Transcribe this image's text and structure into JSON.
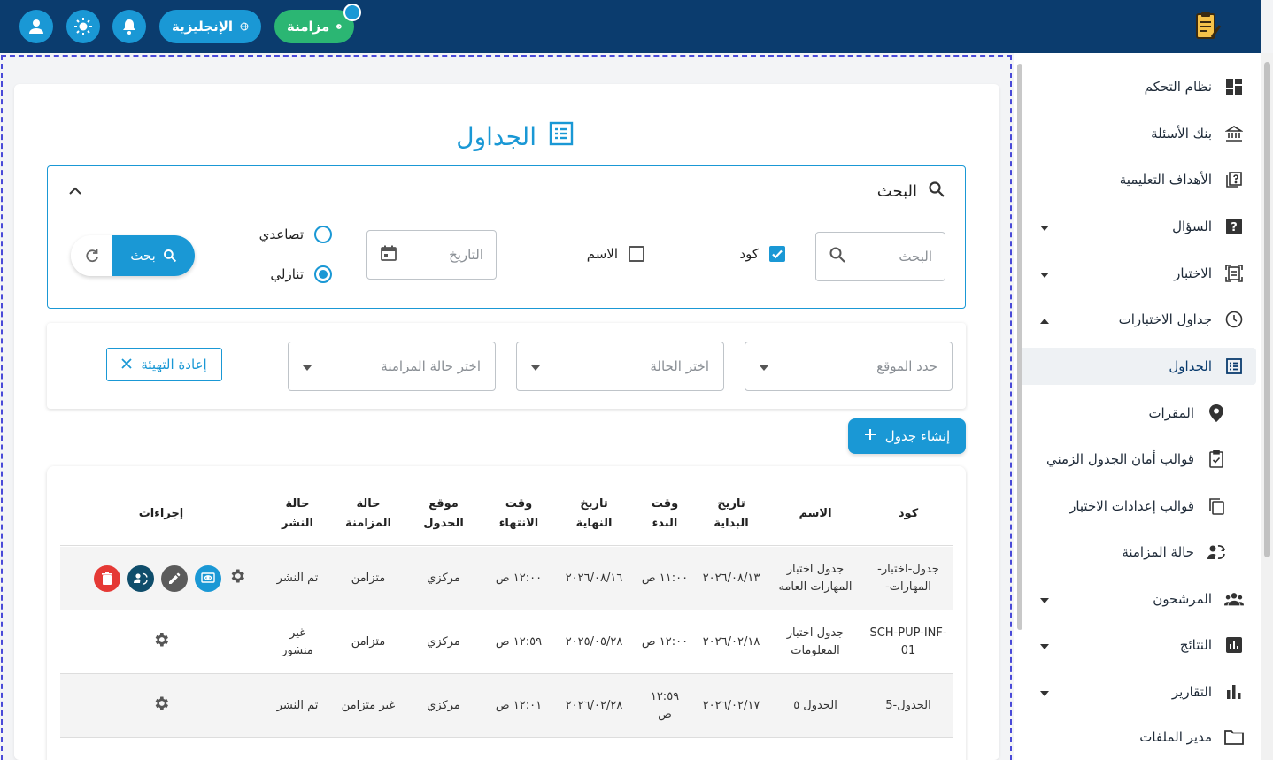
{
  "topbar": {
    "lang_label": "الإنجليزية",
    "sync_label": "مزامنة"
  },
  "sidebar": {
    "items": [
      {
        "label": "نظام التحكم",
        "icon": "dashboard-icon"
      },
      {
        "label": "بنك الأسئلة",
        "icon": "bank-icon"
      },
      {
        "label": "الأهداف التعليمية",
        "icon": "book-question-icon"
      },
      {
        "label": "السؤال",
        "icon": "question-icon"
      },
      {
        "label": "الاختبار",
        "icon": "exam-icon"
      },
      {
        "label": "جداول الاختبارات",
        "icon": "clock-icon"
      },
      {
        "label": "الجداول",
        "icon": "list-icon"
      },
      {
        "label": "المقرات",
        "icon": "location-icon"
      },
      {
        "label": "قوالب أمان الجدول الزمني",
        "icon": "clipboard-check-icon"
      },
      {
        "label": "قوالب إعدادات الاختبار",
        "icon": "copy-icon"
      },
      {
        "label": "حالة المزامنة",
        "icon": "sync-status-icon"
      },
      {
        "label": "المرشحون",
        "icon": "people-icon"
      },
      {
        "label": "النتائج",
        "icon": "chart-box-icon"
      },
      {
        "label": "التقارير",
        "icon": "bar-chart-icon"
      },
      {
        "label": "مدير الملفات",
        "icon": "folder-icon"
      }
    ]
  },
  "main": {
    "title": "الجداول",
    "search": {
      "heading": "البحث",
      "input_placeholder": "البحث",
      "code_label": "كود",
      "code_checked": true,
      "name_label": "الاسم",
      "name_checked": false,
      "date_placeholder": "التاريخ",
      "asc_label": "تصاعدي",
      "desc_label": "تنازلي",
      "selected_order": "desc",
      "search_button": "بحث"
    },
    "filters": {
      "location_placeholder": "حدد الموقع",
      "status_placeholder": "اختر الحالة",
      "sync_placeholder": "اختر حالة المزامنة",
      "reset_label": "إعادة التهيئة"
    },
    "create_button": "إنشاء جدول",
    "table": {
      "headers": {
        "code": "كود",
        "name": "الاسم",
        "start_date": "تاريخ البداية",
        "start_time": "وقت البدء",
        "end_date": "تاريخ النهاية",
        "end_time": "وقت الانتهاء",
        "location": "موقع الجدول",
        "sync_status": "حالة المزامنة",
        "publish_status": "حالة النشر",
        "actions": "إجراءات"
      },
      "rows": [
        {
          "code": "جدول-اختبار-المهارات-",
          "name": "جدول اختبار المهارات العامه",
          "start_date": "٢٠٢٦/٠٨/١٣",
          "start_time": "١١:٠٠ ص",
          "end_date": "٢٠٢٦/٠٨/١٦",
          "end_time": "١٢:٠٠ ص",
          "location": "مركزي",
          "sync_status": "متزامن",
          "publish_status": "تم النشر"
        },
        {
          "code": "SCH-PUP-INF-01",
          "name": "جدول اختبار المعلومات",
          "start_date": "٢٠٢٦/٠٢/١٨",
          "start_time": "١٢:٠٠ ص",
          "end_date": "٢٠٢٥/٠٥/٢٨",
          "end_time": "١٢:٥٩ ص",
          "location": "مركزي",
          "sync_status": "متزامن",
          "publish_status": "غير منشور"
        },
        {
          "code": "الجدول-5",
          "name": "الجدول ٥",
          "start_date": "٢٠٢٦/٠٢/١٧",
          "start_time": "١٢:٥٩ ص",
          "end_date": "٢٠٢٦/٠٢/٢٨",
          "end_time": "١٢:٠١ ص",
          "location": "مركزي",
          "sync_status": "غير متزامن",
          "publish_status": "تم النشر"
        }
      ]
    }
  },
  "colors": {
    "topbar": "#0b3c6e",
    "accent": "#1a98d5",
    "sync_green": "#2bb673",
    "delete_red": "#e53935",
    "dark_action": "#0f4d6b"
  }
}
